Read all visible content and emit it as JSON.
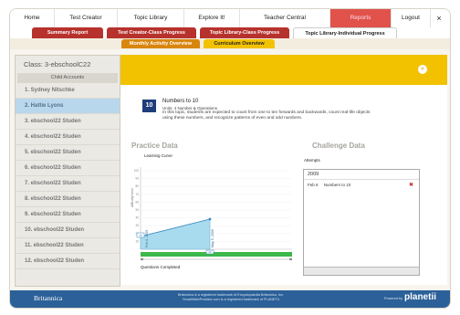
{
  "topnav": {
    "tabs": [
      "Home",
      "Test Creator",
      "Topic Library",
      "Explore It!",
      "Teacher Central",
      "Reports"
    ],
    "active": "Reports",
    "logout": "Logout",
    "close": "×"
  },
  "subnav": {
    "tabs": [
      "Summary Report",
      "Test Creator-Class Progress",
      "Topic Library-Class Progress",
      "Topic Library-Individual Progress"
    ],
    "active": "Topic Library-Individual Progress"
  },
  "row3": {
    "tabs": [
      "Monthly Activity Overview",
      "Curriculum Overview"
    ],
    "active": "Curriculum Overview"
  },
  "left": {
    "class_title": "Class: 3-ebschoolC22",
    "child_accounts": "Child Accounts",
    "students": [
      "1. Sydney Nitschke",
      "2. Hattie Lyons",
      "3. ebschool22 Studen",
      "4. ebschool22 Studen",
      "5. ebschool22 Studen",
      "6. ebschool22 Studen",
      "7. ebschool22 Studen",
      "8. ebschool22 Studen",
      "9. ebschool22 Studen",
      "10. ebschool22 Studen",
      "11. ebschool22 Studen",
      "12. ebschool22 Studen"
    ],
    "selected_index": 1
  },
  "topic": {
    "number": "10",
    "title": "Numbers to 10",
    "units": "Units: 4   Number & Operations",
    "description": "In this topic, students are expected to count from one to ten forwards and backwards, count real-life objects using these numbers, and recognize patterns of even and odd numbers."
  },
  "practice": {
    "title": "Practice Data",
    "curve_label": "Learning Curve",
    "y_axis_label": "difficulty level",
    "ticks": [
      "100",
      "90",
      "80",
      "70",
      "60",
      "50",
      "40",
      "30",
      "20",
      "10"
    ],
    "marker_start": "10",
    "marker_mid": "20",
    "date_start": "Feb 6, 2009",
    "date_end": "May 5, 2009",
    "questions_label": "Questions Completed"
  },
  "challenge": {
    "title": "Challenge Data",
    "attempts_label": "Attempts",
    "year": "2009",
    "rows": [
      {
        "date": "Feb 6",
        "name": "Numbers to 10"
      }
    ]
  },
  "footer": {
    "logo": "Britannica",
    "logo_sub": "Digital Learning",
    "trademark1": "Britannica is a registered trademark of Encyclopaedia Britannica, Inc.",
    "trademark2": "SmartMathPractice.com is a registered trademark of PLANETII",
    "powered": "Powered by",
    "brand": "planetii"
  },
  "colors": {
    "reports_tab": "#e0524a",
    "subnav_tab": "#b7322d",
    "yellow": "#f2c200",
    "footer": "#2b6098",
    "selected": "#b9d7ec",
    "curve_fill": "#a9dbee",
    "progress_green": "#3db84a"
  }
}
